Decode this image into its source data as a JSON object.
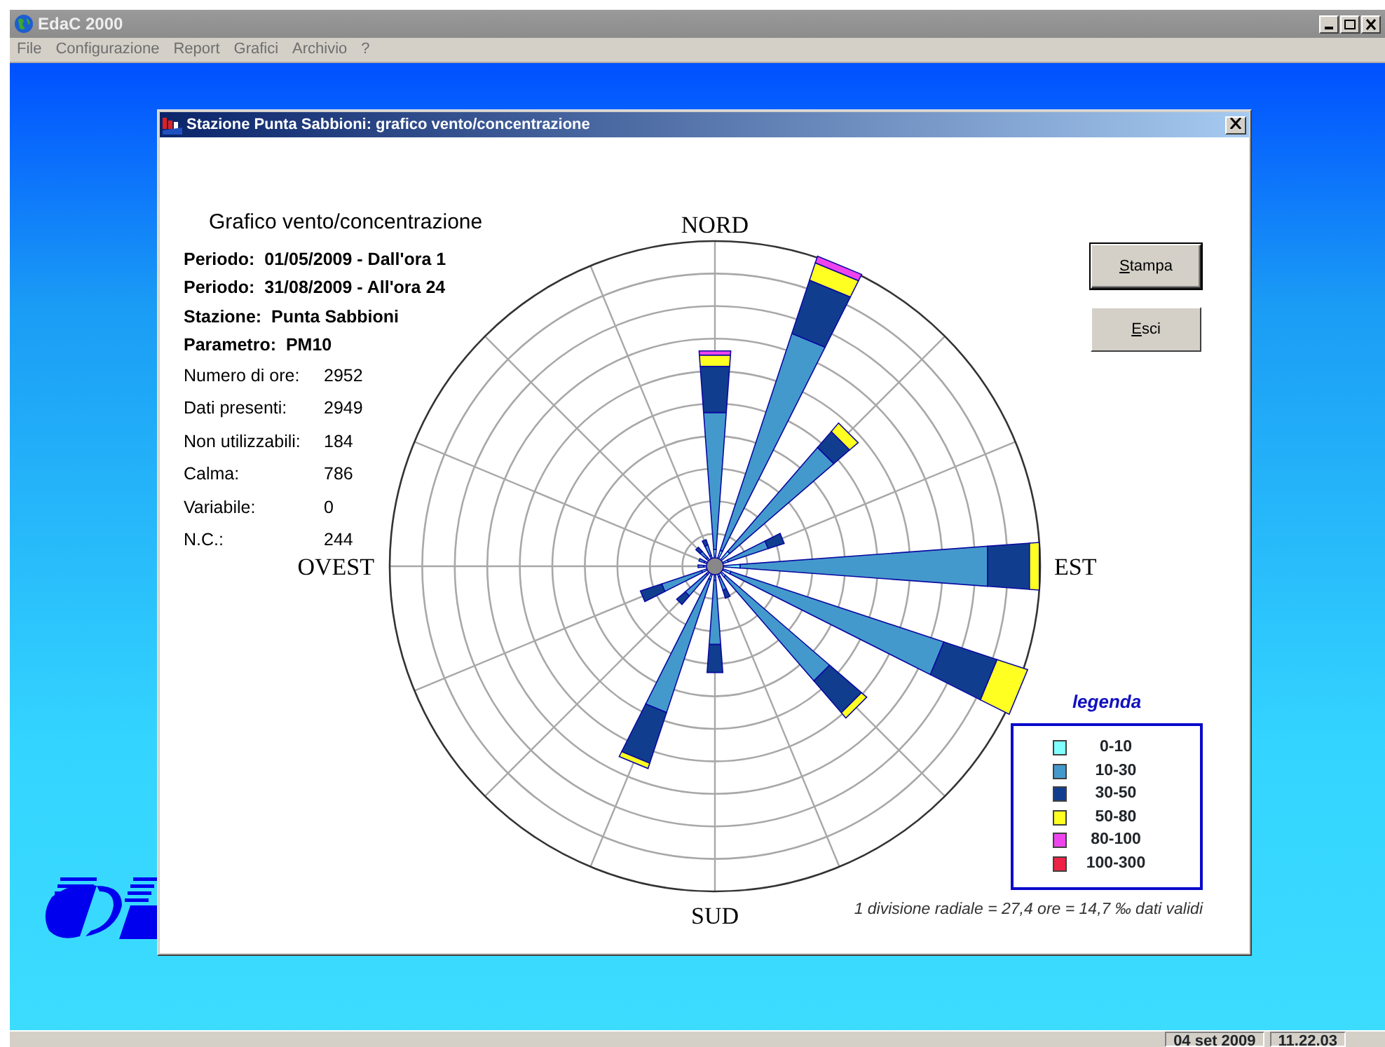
{
  "app": {
    "title": "EdaC 2000",
    "menu": [
      "File",
      "Configurazione",
      "Report",
      "Grafici",
      "Archivio",
      "?"
    ]
  },
  "dialog": {
    "title": "Stazione Punta Sabbioni: grafico vento/concentrazione",
    "heading": "Grafico vento/concentrazione",
    "details": [
      "Periodo:  01/05/2009 - Dall'ora 1",
      "Periodo:  31/08/2009 - All'ora 24",
      "Stazione:  Punta Sabbioni",
      "Parametro:  PM10"
    ],
    "stats": [
      {
        "label": "Numero di ore:",
        "value": "2952"
      },
      {
        "label": "Dati presenti:",
        "value": "2949"
      },
      {
        "label": "Non utilizzabili:",
        "value": "184"
      },
      {
        "label": "Calma:",
        "value": "786"
      },
      {
        "label": "Variabile:",
        "value": "0"
      },
      {
        "label": "N.C.:",
        "value": "244"
      }
    ],
    "compass": {
      "north": "NORD",
      "east": "EST",
      "south": "SUD",
      "west": "OVEST"
    },
    "buttons": [
      {
        "label": "Stampa",
        "focused": true
      },
      {
        "label": "Esci",
        "focused": false
      }
    ],
    "legend": {
      "title": "legenda",
      "items": [
        {
          "label": "0-10",
          "color": "#80ffff"
        },
        {
          "label": "10-30",
          "color": "#4499cc"
        },
        {
          "label": "30-50",
          "color": "#113d8f"
        },
        {
          "label": "50-80",
          "color": "#ffff22"
        },
        {
          "label": "80-100",
          "color": "#ee44ee"
        },
        {
          "label": "100-300",
          "color": "#ee2244"
        }
      ]
    },
    "footnote": "1 divisione radiale = 27,4 ore = 14,7 ‰ dati validi"
  },
  "status_bar": {
    "date": "04 set 2009",
    "time": "11.22.03"
  }
}
